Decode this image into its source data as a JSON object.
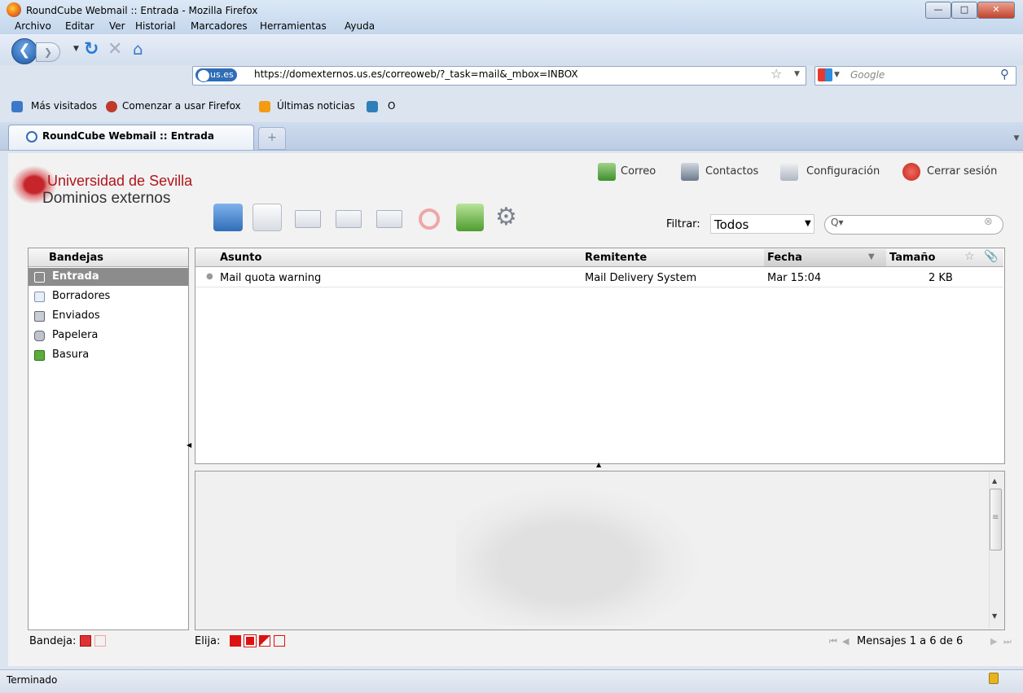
{
  "window": {
    "title": "RoundCube Webmail :: Entrada - Mozilla Firefox",
    "min_label": "—",
    "max_label": "□",
    "close_label": "✕"
  },
  "menu": [
    "Archivo",
    "Editar",
    "Ver",
    "Historial",
    "Marcadores",
    "Herramientas",
    "Ayuda"
  ],
  "nav": {
    "site_badge": "us.es",
    "url": "https://domexternos.us.es/correoweb/?_task=mail&_mbox=INBOX",
    "search_placeholder": "Google"
  },
  "bookmarks": [
    "Más visitados",
    "Comenzar a usar Firefox",
    "Últimas noticias",
    "O"
  ],
  "tab": {
    "label": "RoundCube Webmail :: Entrada",
    "new_tab": "+"
  },
  "logo": {
    "name": "Universidad de Sevilla",
    "subtitle": "Dominios externos"
  },
  "topnav": {
    "mail": "Correo",
    "contacts": "Contactos",
    "settings": "Configuración",
    "logout": "Cerrar sesión"
  },
  "filter": {
    "label": "Filtrar:",
    "value": "Todos"
  },
  "folders": {
    "title": "Bandejas",
    "items": [
      {
        "label": "Entrada",
        "selected": true
      },
      {
        "label": "Borradores"
      },
      {
        "label": "Enviados"
      },
      {
        "label": "Papelera"
      },
      {
        "label": "Basura"
      }
    ]
  },
  "list": {
    "columns": {
      "subject": "Asunto",
      "from": "Remitente",
      "date": "Fecha",
      "size": "Tamaño"
    },
    "rows": [
      {
        "subject": "Mail quota warning",
        "from": "Mail Delivery System",
        "date": "Mar 15:04",
        "size": "2 KB"
      }
    ]
  },
  "footer": {
    "folder_label": "Bandeja:",
    "select_label": "Elija:",
    "pager": "Mensajes 1 a 6 de 6"
  },
  "status": {
    "text": "Terminado"
  },
  "colors": {
    "selected_folder": "#8c8c8c",
    "brand_red": "#b0151b"
  }
}
